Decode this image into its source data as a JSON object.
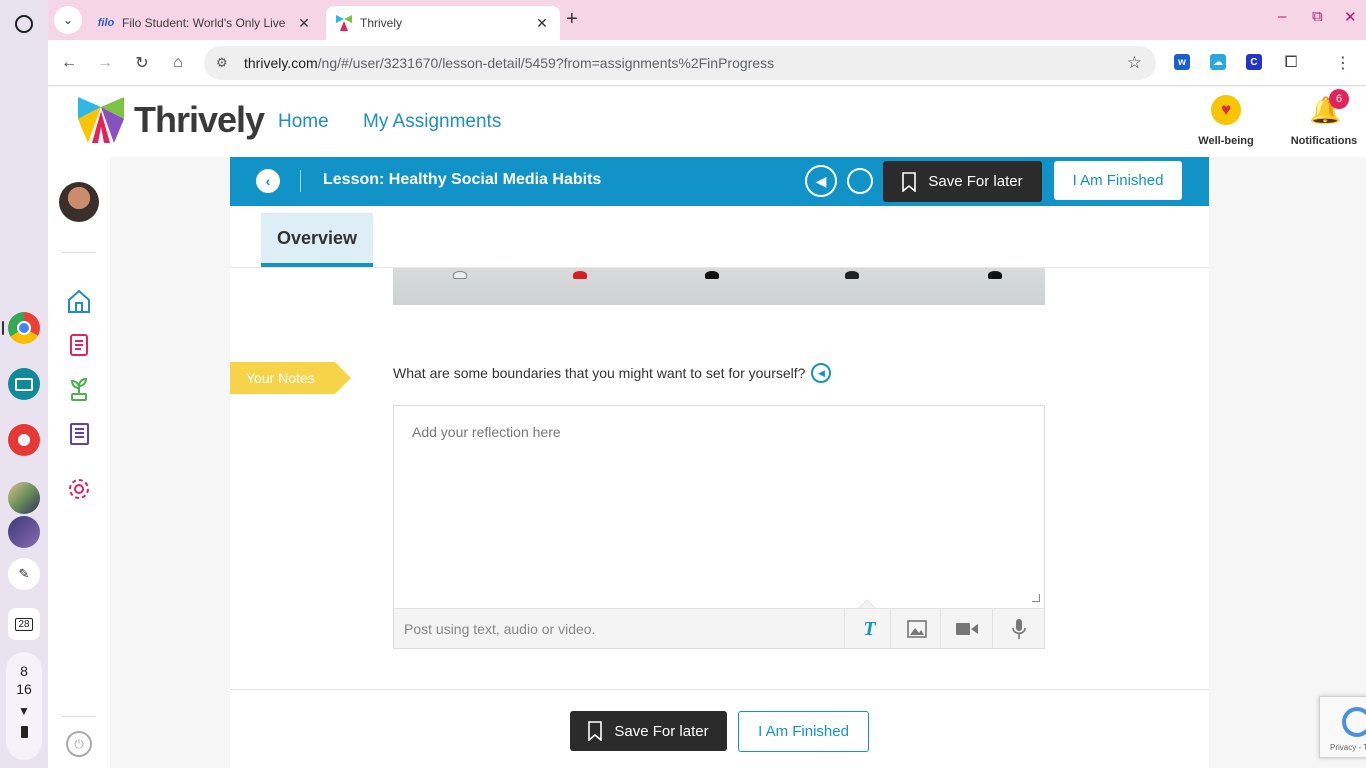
{
  "shelf": {
    "date": "28",
    "time_hour": "8",
    "time_minute": "16"
  },
  "browser": {
    "tabs": [
      {
        "title": "Filo Student: World's Only Live",
        "favicon": "filo",
        "active": false
      },
      {
        "title": "Thrively",
        "favicon": "thrively-logo",
        "active": true
      }
    ],
    "url_domain": "thrively.com",
    "url_path": "/ng/#/user/3231670/lesson-detail/5459?from=assignments%2FinProgress"
  },
  "app": {
    "logo_text": "Thrively",
    "nav": [
      "Home",
      "My Assignments"
    ],
    "wellbeing_label": "Well-being",
    "notifications_label": "Notifications",
    "notifications_count": "6"
  },
  "lesson": {
    "title": "Lesson: Healthy Social Media Habits",
    "save_label": "Save For later",
    "finish_label": "I Am Finished",
    "tab_overview": "Overview"
  },
  "notes": {
    "flag_label": "Your Notes",
    "question": "What are some boundaries that you might want to set for yourself?",
    "placeholder": "Add your reflection here",
    "post_hint": "Post using text, audio or video."
  },
  "footer": {
    "save_label": "Save For later",
    "finish_label": "I Am Finished"
  },
  "recaptcha": {
    "text": "Privacy - T"
  },
  "colors": {
    "primary": "#1193c8",
    "dark_button": "#2b2b2b",
    "notes_flag": "#f7d34a",
    "badge": "#e2245a",
    "tabstrip": "#f6d6e6"
  }
}
